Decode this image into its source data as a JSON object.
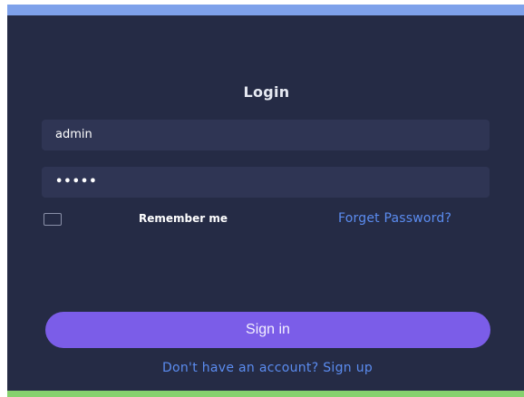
{
  "login": {
    "title": "Login",
    "username_value": "admin",
    "password_value": "•••••",
    "remember_label": "Remember me",
    "forgot_label": "Forget Password?",
    "signin_label": "Sign in",
    "signup_label": "Don't have an account? Sign up"
  },
  "colors": {
    "panel": "#252b45",
    "field": "#2f3554",
    "accent_button": "#7b5de8",
    "link": "#5b8cf0",
    "top_bar": "#7ea1ea",
    "bottom_bar": "#86d16e"
  }
}
